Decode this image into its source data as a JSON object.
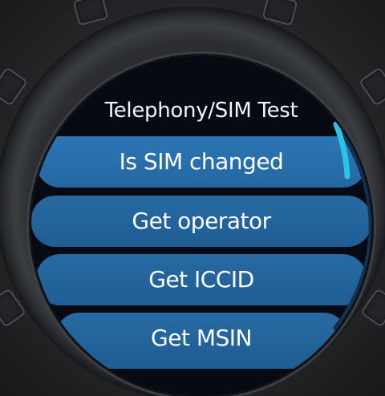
{
  "screen": {
    "title": "Telephony/SIM Test"
  },
  "menu": {
    "items": [
      {
        "label": "Is SIM changed"
      },
      {
        "label": "Get operator"
      },
      {
        "label": "Get ICCID"
      },
      {
        "label": "Get MSIN"
      }
    ]
  },
  "scroll": {
    "position_fraction": 0.08
  },
  "colors": {
    "item_bg": "#1f5d93",
    "scroll_thumb": "#29c4e8",
    "title_text": "#f4f4f4"
  }
}
